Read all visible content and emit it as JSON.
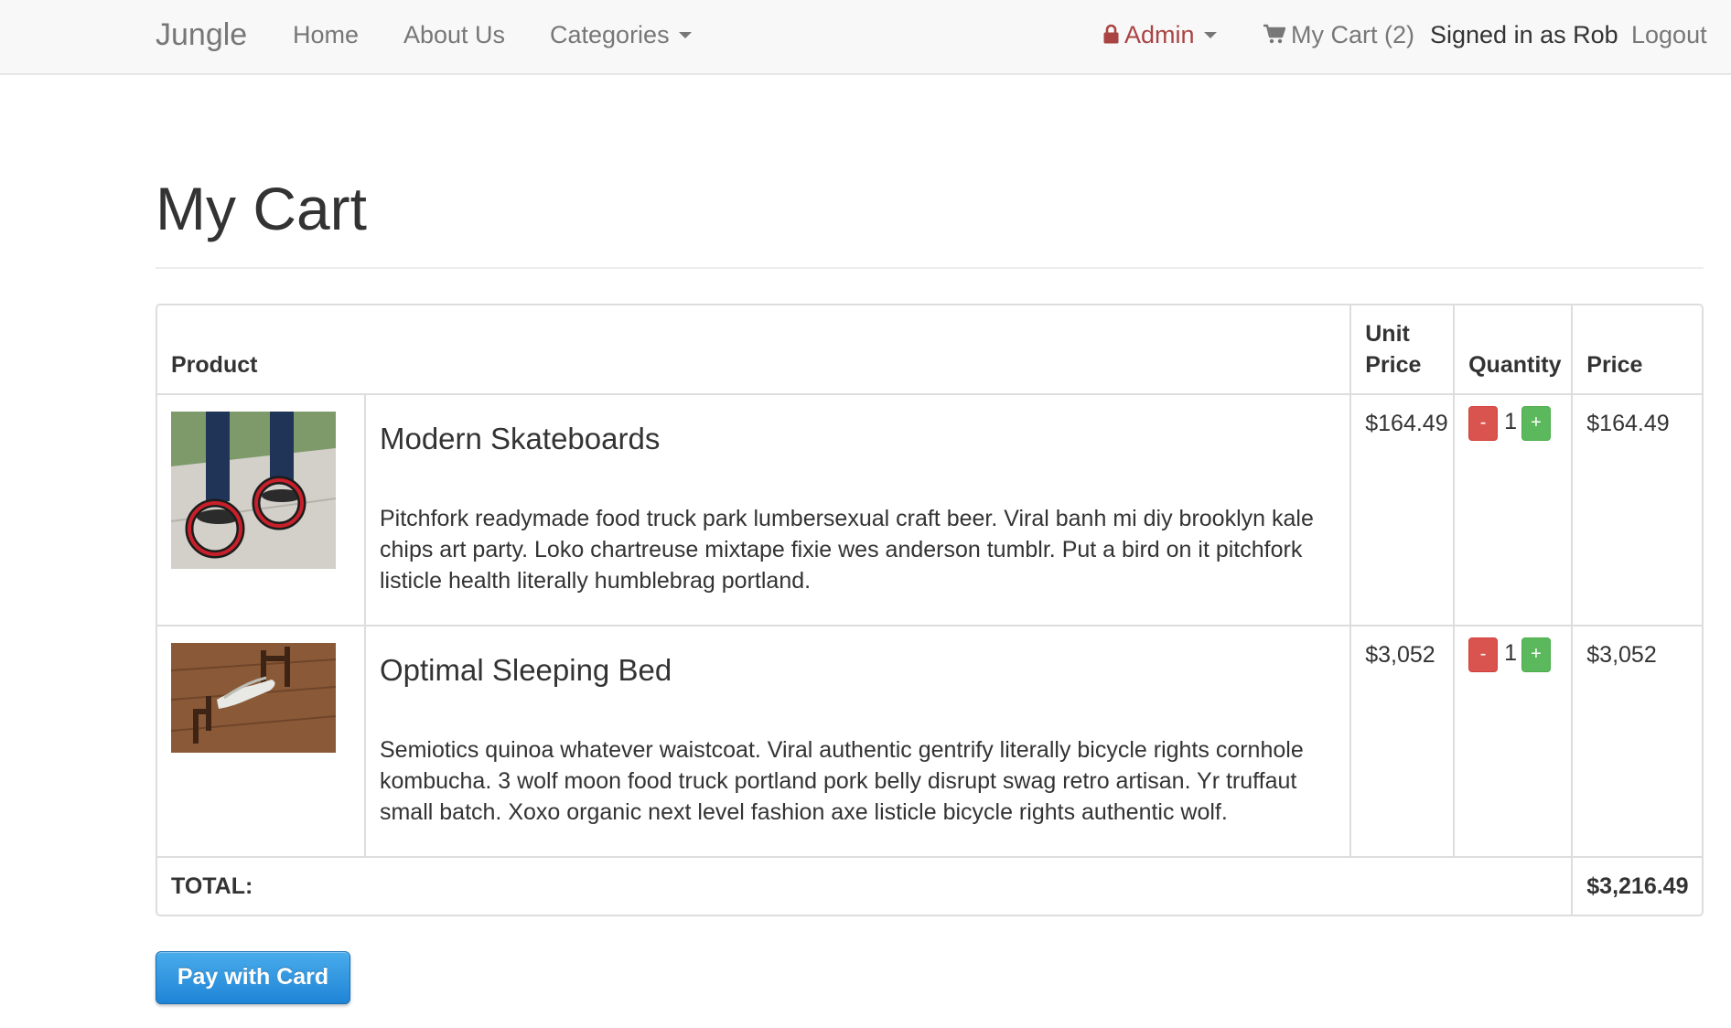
{
  "navbar": {
    "brand": "Jungle",
    "home": "Home",
    "about": "About Us",
    "categories": "Categories",
    "admin": "Admin",
    "cart": "My Cart (2)",
    "signed_in": "Signed in as Rob",
    "logout": "Logout",
    "admin_color": "#a94442",
    "icons": [
      "lock-icon",
      "cart-icon",
      "caret-down-icon"
    ]
  },
  "page": {
    "title": "My Cart"
  },
  "cart": {
    "headers": {
      "product": "Product",
      "unit_price": "Unit Price",
      "quantity": "Quantity",
      "price": "Price"
    },
    "items": [
      {
        "name": "Modern Skateboards",
        "description": "Pitchfork readymade food truck park lumbersexual craft beer. Viral banh mi diy brooklyn kale chips art party. Loko chartreuse mixtape fixie wes anderson tumblr. Put a bird on it pitchfork listicle health literally humblebrag portland.",
        "unit_price": "$164.49",
        "quantity": "1",
        "price": "$164.49",
        "minus_label": "-",
        "plus_label": "+"
      },
      {
        "name": "Optimal Sleeping Bed",
        "description": "Semiotics quinoa whatever waistcoat. Viral authentic gentrify literally bicycle rights cornhole kombucha. 3 wolf moon food truck portland pork belly disrupt swag retro artisan. Yr truffaut small batch. Xoxo organic next level fashion axe listicle bicycle rights authentic wolf.",
        "unit_price": "$3,052",
        "quantity": "1",
        "price": "$3,052",
        "minus_label": "-",
        "plus_label": "+"
      }
    ],
    "total_label": "TOTAL:",
    "total_value": "$3,216.49",
    "minus_color": "#d9534f",
    "plus_color": "#5cb85c"
  },
  "pay_button": {
    "label": "Pay with Card",
    "color": "#1f84d6"
  }
}
